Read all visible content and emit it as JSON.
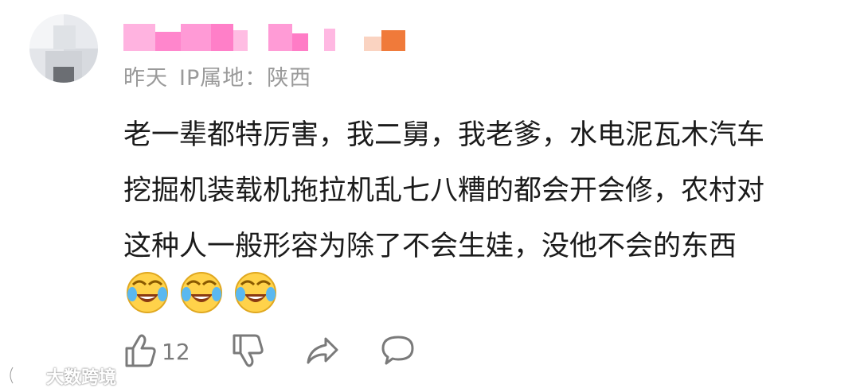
{
  "comment": {
    "meta": {
      "time": "昨天",
      "ip_location": "IP属地：陕西"
    },
    "lines": [
      "老一辈都特厉害，我二舅，我老爹，水电泥瓦木汽车",
      "挖掘机装载机拖拉机乱七八糟的都会开会修，农村对",
      "这种人一般形容为除了不会生娃，没他不会的东西"
    ],
    "emojis": [
      "laughing-tears-emoji",
      "laughing-tears-emoji",
      "laughing-tears-emoji"
    ],
    "actions": {
      "like_count": "12",
      "icons": [
        "thumbs-up-icon",
        "thumbs-down-icon",
        "share-icon",
        "comment-icon"
      ]
    }
  },
  "watermark": {
    "text": "大数跨境"
  },
  "colors": {
    "username_pink": "#ff8fd0",
    "username_orange": "#f07a3a",
    "meta_gray": "#9a9a9a",
    "text": "#1b1b1b",
    "icon_gray": "#7a7a7a"
  }
}
